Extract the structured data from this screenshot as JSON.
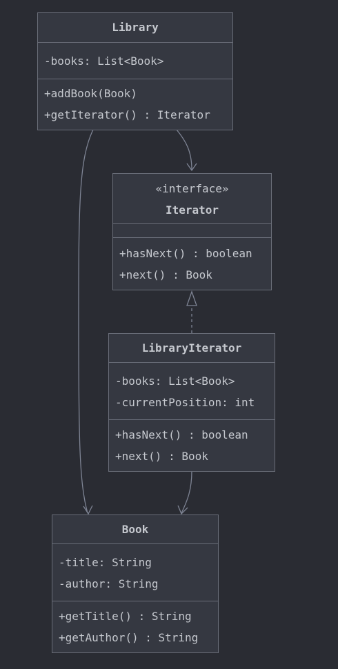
{
  "diagram": {
    "classes": {
      "library": {
        "name": "Library",
        "attributes": [
          "-books: List<Book>"
        ],
        "methods": [
          "+addBook(Book)",
          "+getIterator() : Iterator"
        ]
      },
      "iterator": {
        "stereotype": "«interface»",
        "name": "Iterator",
        "attributes": [],
        "methods": [
          "+hasNext() : boolean",
          "+next() : Book"
        ]
      },
      "library_iterator": {
        "name": "LibraryIterator",
        "attributes": [
          "-books: List<Book>",
          "-currentPosition: int"
        ],
        "methods": [
          "+hasNext() : boolean",
          "+next() : Book"
        ]
      },
      "book": {
        "name": "Book",
        "attributes": [
          "-title: String",
          "-author: String"
        ],
        "methods": [
          "+getTitle() : String",
          "+getAuthor() : String"
        ]
      }
    },
    "relations": [
      {
        "from": "Library",
        "to": "Iterator",
        "kind": "association"
      },
      {
        "from": "Library",
        "to": "Book",
        "kind": "association"
      },
      {
        "from": "LibraryIterator",
        "to": "Iterator",
        "kind": "realization"
      },
      {
        "from": "LibraryIterator",
        "to": "Book",
        "kind": "association"
      }
    ],
    "colors": {
      "background": "#2a2c33",
      "box_fill": "#353841",
      "box_border": "#6a6e79",
      "text": "#c5c8ce",
      "edge": "#7e8494"
    }
  }
}
